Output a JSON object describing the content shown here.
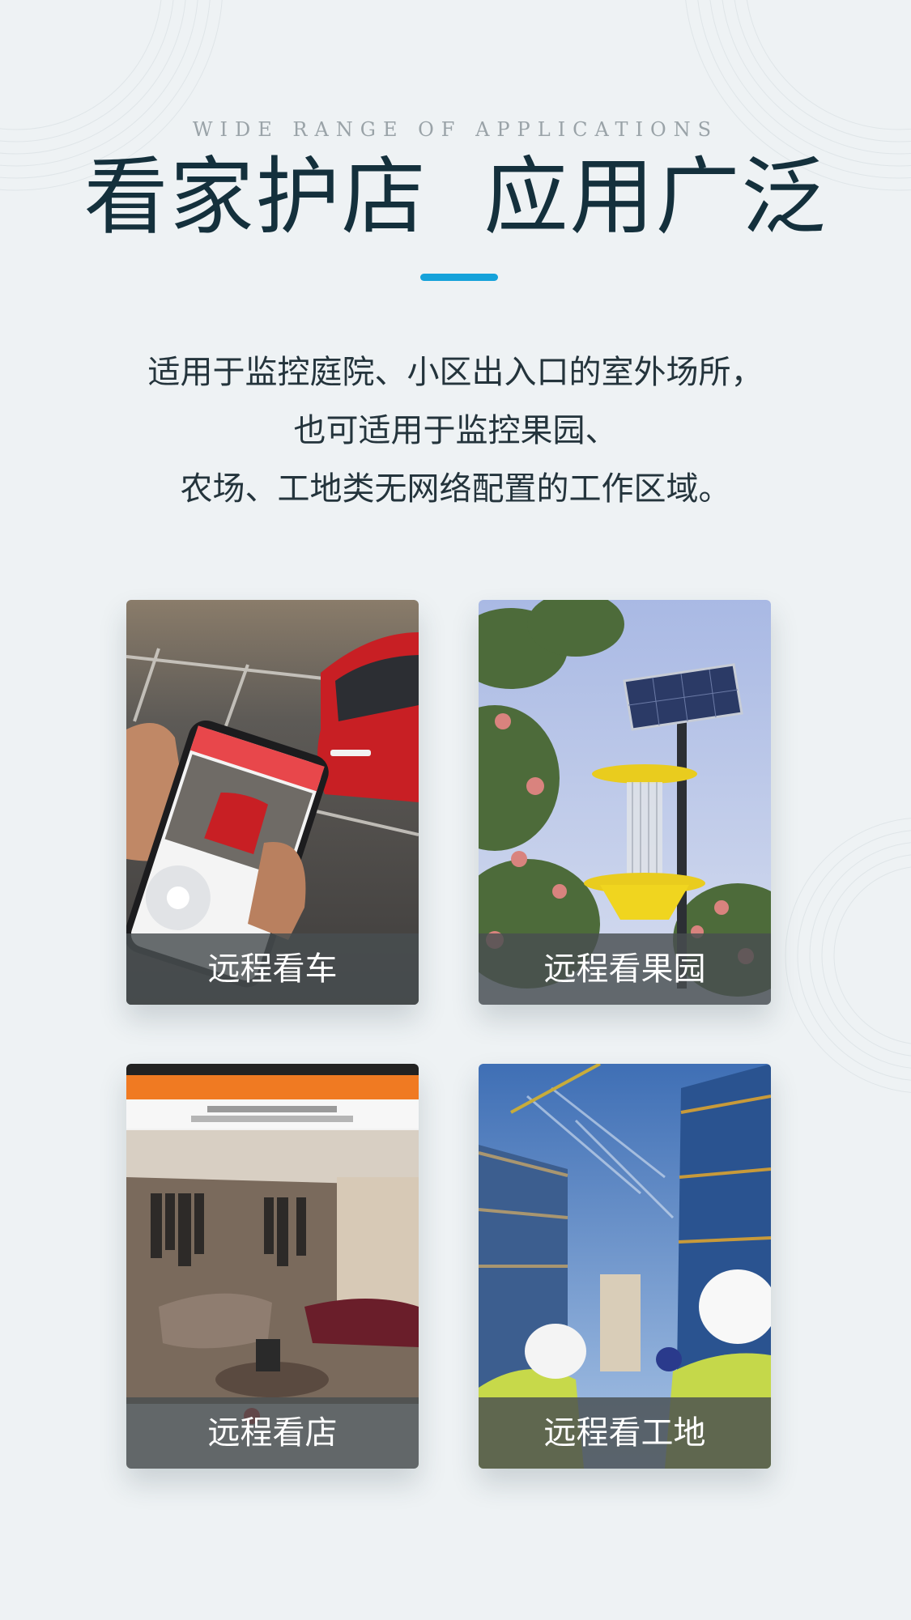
{
  "header": {
    "eyebrow": "WIDE RANGE OF APPLICATIONS",
    "title": "看家护店  应用广泛"
  },
  "description": {
    "lines": [
      "适用于监控庭院、小区出入口的室外场所，",
      "也可适用于监控果园、",
      "农场、工地类无网络配置的工作区域。"
    ]
  },
  "cards": [
    {
      "label": "远程看车"
    },
    {
      "label": "远程看果园"
    },
    {
      "label": "远程看店"
    },
    {
      "label": "远程看工地"
    }
  ],
  "colors": {
    "background": "#eef2f4",
    "title": "#14303c",
    "accent": "#15a2da",
    "caption_bg": "#484e50"
  }
}
